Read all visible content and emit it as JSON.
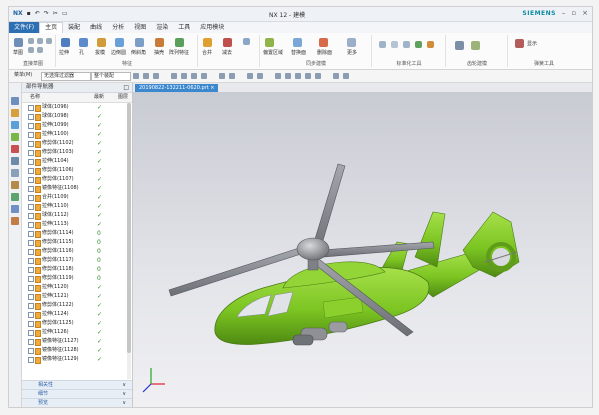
{
  "window": {
    "title": "NX 12 - 建模",
    "brand": "SIEMENS",
    "quick_access": "NX",
    "controls": [
      "–",
      "▫",
      "×"
    ]
  },
  "menubar": {
    "items": [
      "文件(F)",
      "主页",
      "装配",
      "曲线",
      "分析",
      "视图",
      "渲染",
      "工具",
      "应用模块"
    ]
  },
  "ribbon": {
    "groups": [
      "直接草图",
      "特征",
      "同步建模",
      "标准化工具",
      "齿轮建模",
      "弹簧工具"
    ],
    "labels": [
      "草图",
      "拉伸",
      "孔",
      "拔模",
      "边倒圆",
      "倒斜角",
      "抽壳",
      "阵列特征",
      "合并",
      "减去",
      "偏置区域",
      "替换面",
      "删除面",
      "更多",
      "显示"
    ]
  },
  "toolbar2": {
    "menu_label": "菜单(M)",
    "filter": "无选择过滤器",
    "scope": "整个装配"
  },
  "document_tab": "20190822-132211-0620.prt ×",
  "navigator": {
    "title": "部件导航器",
    "columns": [
      "名称",
      "最新",
      "图层"
    ],
    "items": [
      {
        "name": "球体(1096)",
        "mark": "✓"
      },
      {
        "name": "球体(1098)",
        "mark": "✓"
      },
      {
        "name": "拉伸(1099)",
        "mark": "✓"
      },
      {
        "name": "拉伸(1100)",
        "mark": "✓"
      },
      {
        "name": "修剪体(1102)",
        "mark": "✓"
      },
      {
        "name": "修剪体(1103)",
        "mark": "✓"
      },
      {
        "name": "拉伸(1104)",
        "mark": "✓"
      },
      {
        "name": "修剪体(1106)",
        "mark": "✓"
      },
      {
        "name": "修剪体(1107)",
        "mark": "✓"
      },
      {
        "name": "镜像特征(1108)",
        "mark": "✓"
      },
      {
        "name": "合并(1109)",
        "mark": "✓"
      },
      {
        "name": "拉伸(1110)",
        "mark": "✓"
      },
      {
        "name": "球体(1112)",
        "mark": "✓"
      },
      {
        "name": "拉伸(1113)",
        "mark": "✓"
      },
      {
        "name": "修剪体(1114)",
        "mark": "0"
      },
      {
        "name": "修剪体(1115)",
        "mark": "0"
      },
      {
        "name": "修剪体(1116)",
        "mark": "0"
      },
      {
        "name": "修剪体(1117)",
        "mark": "0"
      },
      {
        "name": "修剪体(1118)",
        "mark": "0"
      },
      {
        "name": "修剪体(1119)",
        "mark": "0"
      },
      {
        "name": "拉伸(1120)",
        "mark": "✓"
      },
      {
        "name": "拉伸(1121)",
        "mark": "✓"
      },
      {
        "name": "修剪体(1122)",
        "mark": "✓"
      },
      {
        "name": "拉伸(1124)",
        "mark": "✓"
      },
      {
        "name": "修剪体(1125)",
        "mark": "✓"
      },
      {
        "name": "拉伸(1126)",
        "mark": "✓"
      },
      {
        "name": "镜像特征(1127)",
        "mark": "✓"
      },
      {
        "name": "镜像特征(1128)",
        "mark": "✓"
      },
      {
        "name": "镜像特征(1129)",
        "mark": "✓"
      }
    ],
    "panels": [
      "相关性",
      "细节",
      "预览"
    ]
  },
  "colors": {
    "body_green": "#7cc522",
    "accent": "#2c6fb3"
  }
}
